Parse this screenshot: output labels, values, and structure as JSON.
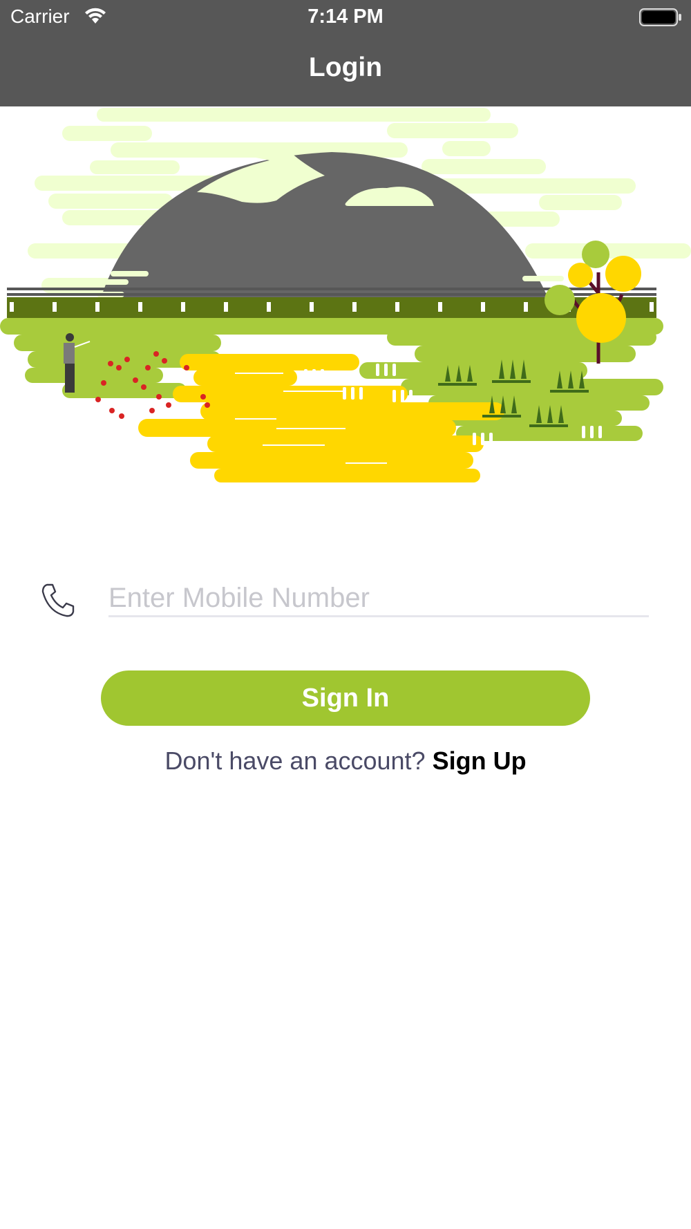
{
  "status_bar": {
    "carrier": "Carrier",
    "time": "7:14 PM",
    "wifi_icon": "wifi-icon",
    "battery_icon": "battery-icon"
  },
  "nav": {
    "title": "Login"
  },
  "illustration": {
    "name": "farm-landscape-illustration"
  },
  "form": {
    "phone_icon": "phone-icon",
    "mobile_placeholder": "Enter Mobile Number",
    "mobile_value": ""
  },
  "signin": {
    "label": "Sign In"
  },
  "signup": {
    "prompt": "Don't have an account?",
    "link": "Sign Up"
  },
  "colors": {
    "header": "#575757",
    "accent_green": "#a0c630",
    "sun_yellow": "#ffd700",
    "sky_light": "#f0ffd0",
    "dark_green": "#5c7413",
    "grass": "#a8cb3c"
  }
}
